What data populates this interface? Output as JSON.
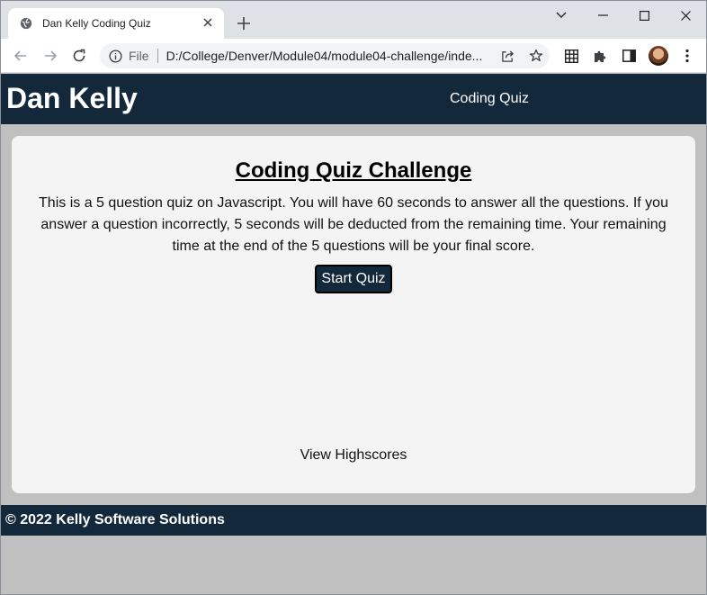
{
  "browser": {
    "tab_title": "Dan Kelly Coding Quiz",
    "omnibox": {
      "scheme_label": "File",
      "url": "D:/College/Denver/Module04/module04-challenge/inde..."
    },
    "icons": [
      "globe-icon",
      "close-icon",
      "plus-icon",
      "chevron-down-icon",
      "minimize-icon",
      "maximize-icon",
      "close-window-icon",
      "back-icon",
      "forward-icon",
      "reload-icon",
      "info-icon",
      "share-icon",
      "star-icon",
      "grid-extension-icon",
      "puzzle-icon",
      "side-panel-icon",
      "kebab-menu-icon"
    ]
  },
  "site": {
    "name": "Dan Kelly",
    "nav_label": "Coding Quiz"
  },
  "quiz": {
    "title": "Coding Quiz Challenge",
    "description": "This is a 5 question quiz on Javascript. You will have 60 seconds to answer all the questions. If you answer a question incorrectly, 5 seconds will be deducted from the remaining time. Your remaining time at the end of the 5 questions will be your final score.",
    "start_label": "Start Quiz",
    "highscores_label": "View Highscores"
  },
  "footer": {
    "text": "© 2022 Kelly Software Solutions"
  },
  "colors": {
    "header_bg": "#14283c",
    "page_bg": "#c0c0c0",
    "card_bg": "#f4f4f4"
  }
}
